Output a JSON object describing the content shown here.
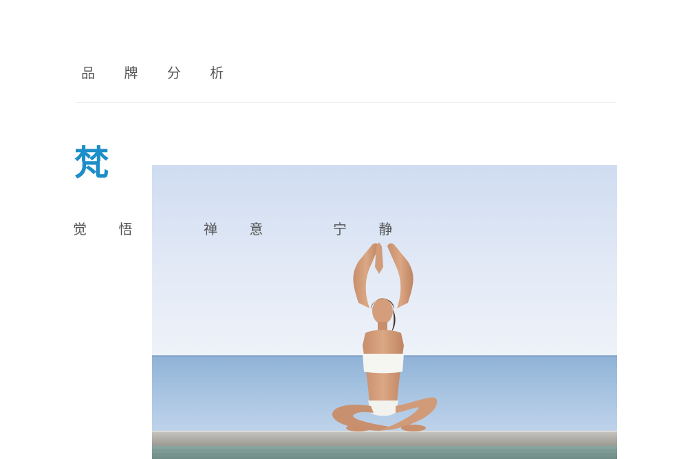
{
  "header": {
    "section_title": "品 牌 分 析"
  },
  "brand": {
    "character": "梵",
    "accent_color": "#1c8ec9"
  },
  "keywords": [
    "觉 悟",
    "禅 意",
    "宁 静"
  ],
  "photo": {
    "subject": "yoga-meditation-by-sea"
  }
}
